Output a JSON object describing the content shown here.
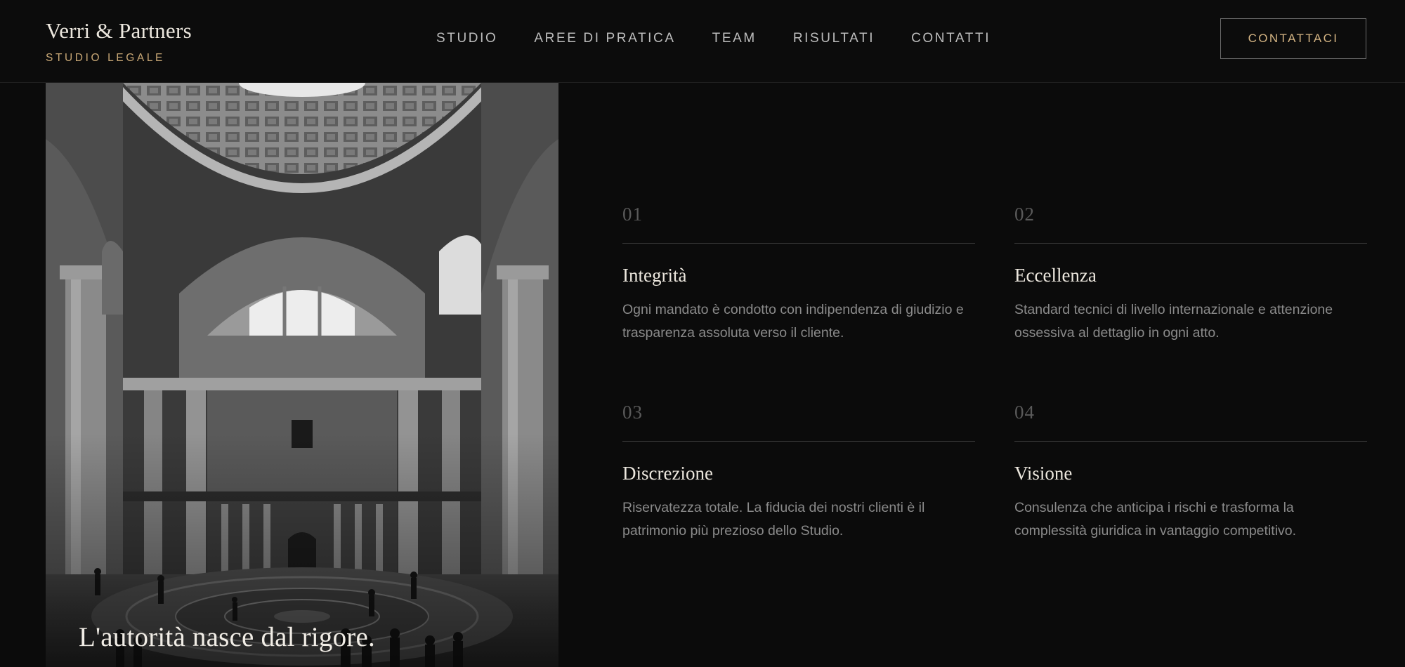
{
  "header": {
    "brand_name": "Verri & Partners",
    "brand_sub": "STUDIO LEGALE",
    "nav": [
      {
        "label": "STUDIO"
      },
      {
        "label": "AREE DI PRATICA"
      },
      {
        "label": "TEAM"
      },
      {
        "label": "RISULTATI"
      },
      {
        "label": "CONTATTI"
      }
    ],
    "cta_label": "CONTATTACI"
  },
  "hero": {
    "caption": "L'autorità nasce dal rigore."
  },
  "values": [
    {
      "num": "01",
      "title": "Integrità",
      "text": "Ogni mandato è condotto con indipendenza di giudizio e trasparenza assoluta verso il cliente."
    },
    {
      "num": "02",
      "title": "Eccellenza",
      "text": "Standard tecnici di livello internazionale e attenzione ossessiva al dettaglio in ogni atto."
    },
    {
      "num": "03",
      "title": "Discrezione",
      "text": "Riservatezza totale. La fiducia dei nostri clienti è il patrimonio più prezioso dello Studio."
    },
    {
      "num": "04",
      "title": "Visione",
      "text": "Consulenza che anticipa i rischi e trasforma la complessità giuridica in vantaggio competitivo."
    }
  ],
  "colors": {
    "background": "#0b0b0b",
    "accent_gold": "#c9a876",
    "text_light": "#ece7de",
    "text_muted": "#8a8a8a"
  }
}
